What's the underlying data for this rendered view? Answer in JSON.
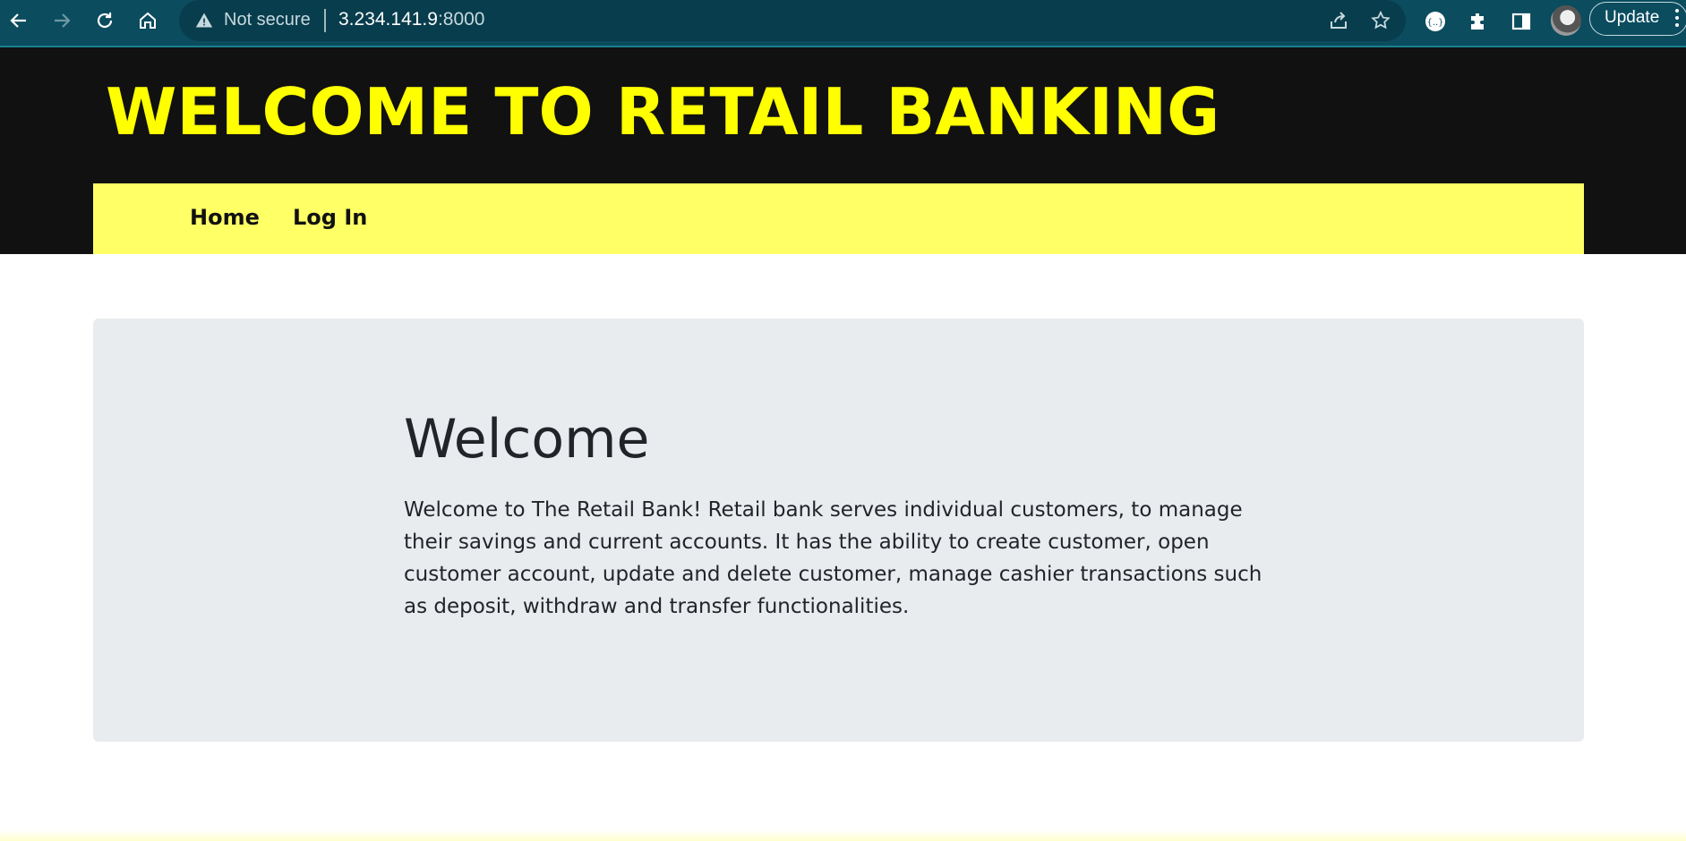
{
  "browser": {
    "security_label": "Not secure",
    "url_host": "3.234.141.9",
    "url_port": ":8000",
    "update_label": "Update",
    "icons": [
      "back-icon",
      "forward-icon",
      "reload-icon",
      "home-icon",
      "warning-icon",
      "share-icon",
      "star-icon",
      "extension-icon",
      "puzzle-icon",
      "side-panel-icon",
      "avatar",
      "menu-icon"
    ]
  },
  "header": {
    "title": "WELCOME TO RETAIL BANKING"
  },
  "nav": {
    "items": [
      {
        "label": "Home"
      },
      {
        "label": "Log In"
      }
    ]
  },
  "main": {
    "heading": "Welcome",
    "body": "Welcome to The Retail Bank! Retail bank serves individual customers, to manage their savings and current accounts. It has the ability to create customer, open customer account, update and delete customer, manage cashier transactions such as deposit, withdraw and transfer functionalities."
  },
  "colors": {
    "header_bg": "#111111",
    "title_color": "#ffff00",
    "nav_bg": "#ffff66",
    "jumbotron_bg": "#e9ecef",
    "chrome_bg": "#0b4c5f"
  }
}
